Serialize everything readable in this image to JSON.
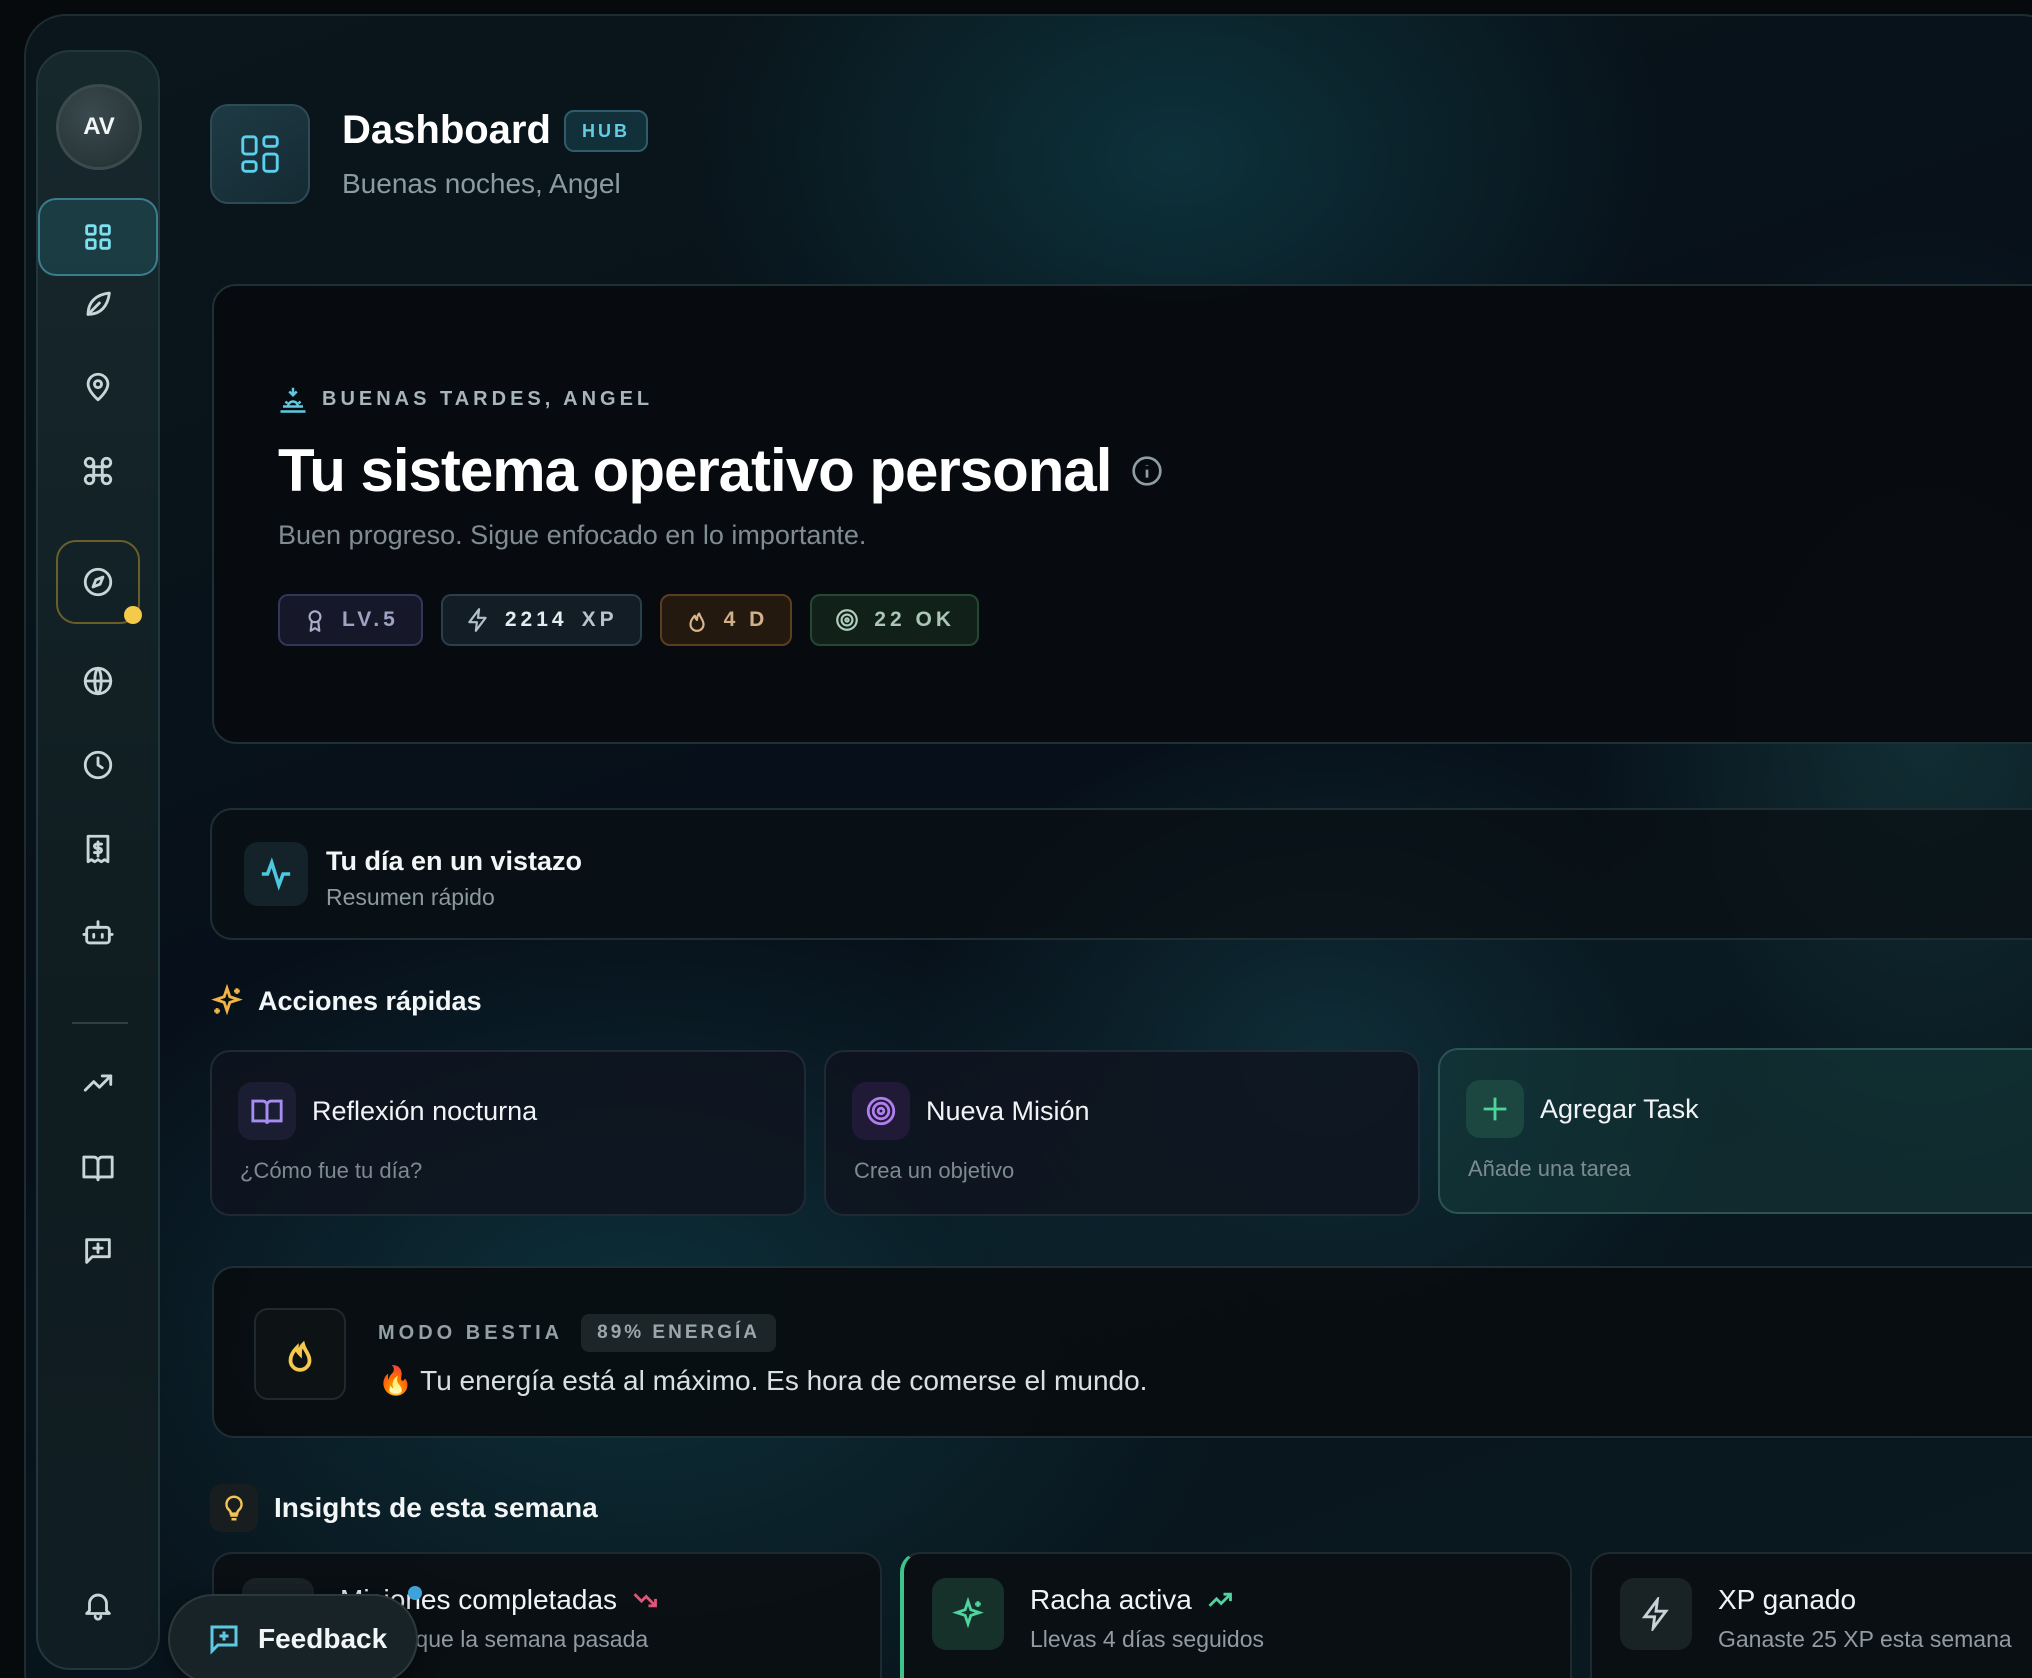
{
  "sidebar": {
    "avatar_initials": "AV",
    "items": [
      {
        "icon": "grid-icon",
        "active": true
      },
      {
        "icon": "leaf-icon"
      },
      {
        "icon": "map-pin-icon"
      },
      {
        "icon": "command-icon"
      },
      {
        "icon": "compass-icon",
        "notification": true
      },
      {
        "icon": "globe-icon"
      },
      {
        "icon": "clock-icon"
      },
      {
        "icon": "receipt-dollar-icon"
      },
      {
        "icon": "bot-icon"
      },
      {
        "icon": "trending-up-icon"
      },
      {
        "icon": "book-open-icon"
      },
      {
        "icon": "message-plus-icon"
      },
      {
        "icon": "bell-icon"
      }
    ]
  },
  "header": {
    "title": "Dashboard",
    "badge": "HUB",
    "subtitle": "Buenas noches, Angel"
  },
  "hero": {
    "kicker": "BUENAS TARDES, ANGEL",
    "title": "Tu sistema operativo personal",
    "subtitle": "Buen progreso. Sigue enfocado en lo importante.",
    "stats": {
      "level": "LV.5",
      "xp_value": "2214",
      "xp_unit": "XP",
      "days": "4 D",
      "ok": "22 OK"
    }
  },
  "day_summary": {
    "title": "Tu día en un vistazo",
    "subtitle": "Resumen rápido"
  },
  "quick_actions": {
    "heading": "Acciones rápidas",
    "items": [
      {
        "title": "Reflexión nocturna",
        "subtitle": "¿Cómo fue tu día?"
      },
      {
        "title": "Nueva Misión",
        "subtitle": "Crea un objetivo"
      },
      {
        "title": "Agregar Task",
        "subtitle": "Añade una tarea"
      }
    ]
  },
  "beast_mode": {
    "label": "MODO BESTIA",
    "energy": "89% ENERGÍA",
    "message": "🔥 Tu energía está al máximo. Es hora de comerse el mundo."
  },
  "insights": {
    "heading": "Insights de esta semana",
    "items": [
      {
        "title": "Misiones completadas",
        "subtitle": "Menos que la semana pasada",
        "trend": "down"
      },
      {
        "title": "Racha activa",
        "subtitle": "Llevas 4 días seguidos",
        "trend": "up"
      },
      {
        "title": "XP ganado",
        "subtitle": "Ganaste 25 XP esta semana"
      }
    ]
  },
  "feedback": {
    "label": "Feedback"
  },
  "colors": {
    "accent": "#5ec9e2",
    "warning": "#f5c94a",
    "success": "#3ec48a",
    "danger": "#e0567a"
  }
}
